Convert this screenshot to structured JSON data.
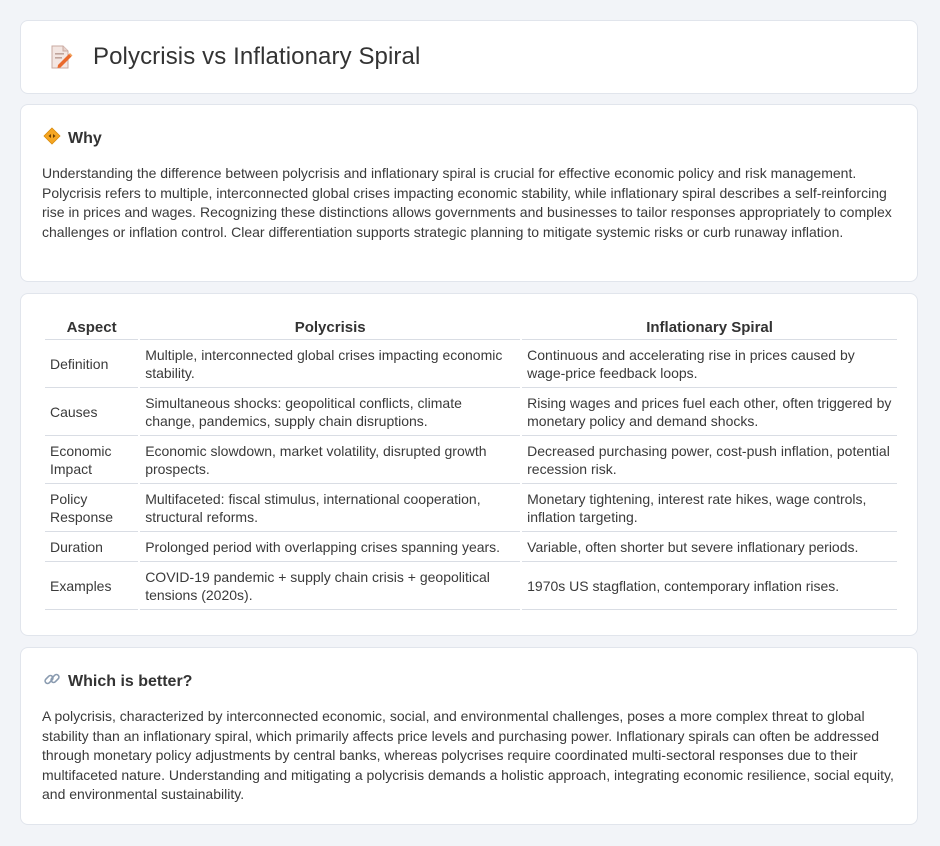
{
  "page": {
    "title": "Polycrisis vs Inflationary Spiral",
    "title_icon": "document-pencil-icon"
  },
  "why": {
    "icon": "diamond-arrows-icon",
    "heading": "Why",
    "body": "Understanding the difference between polycrisis and inflationary spiral is crucial for effective economic policy and risk management. Polycrisis refers to multiple, interconnected global crises impacting economic stability, while inflationary spiral describes a self-reinforcing rise in prices and wages. Recognizing these distinctions allows governments and businesses to tailor responses appropriately to complex challenges or inflation control. Clear differentiation supports strategic planning to mitigate systemic risks or curb runaway inflation."
  },
  "comparison": {
    "headers": [
      "Aspect",
      "Polycrisis",
      "Inflationary Spiral"
    ],
    "rows": [
      {
        "aspect": "Definition",
        "polycrisis": "Multiple, interconnected global crises impacting economic stability.",
        "inflationary": "Continuous and accelerating rise in prices caused by wage-price feedback loops."
      },
      {
        "aspect": "Causes",
        "polycrisis": "Simultaneous shocks: geopolitical conflicts, climate change, pandemics, supply chain disruptions.",
        "inflationary": "Rising wages and prices fuel each other, often triggered by monetary policy and demand shocks."
      },
      {
        "aspect": "Economic Impact",
        "polycrisis": "Economic slowdown, market volatility, disrupted growth prospects.",
        "inflationary": "Decreased purchasing power, cost-push inflation, potential recession risk."
      },
      {
        "aspect": "Policy Response",
        "polycrisis": "Multifaceted: fiscal stimulus, international cooperation, structural reforms.",
        "inflationary": "Monetary tightening, interest rate hikes, wage controls, inflation targeting."
      },
      {
        "aspect": "Duration",
        "polycrisis": "Prolonged period with overlapping crises spanning years.",
        "inflationary": "Variable, often shorter but severe inflationary periods."
      },
      {
        "aspect": "Examples",
        "polycrisis": "COVID-19 pandemic + supply chain crisis + geopolitical tensions (2020s).",
        "inflationary": "1970s US stagflation, contemporary inflation rises."
      }
    ]
  },
  "better": {
    "icon": "link-icon",
    "heading": "Which is better?",
    "body": "A polycrisis, characterized by interconnected economic, social, and environmental challenges, poses a more complex threat to global stability than an inflationary spiral, which primarily affects price levels and purchasing power. Inflationary spirals can often be addressed through monetary policy adjustments by central banks, whereas polycrises require coordinated multi-sectoral responses due to their multifaceted nature. Understanding and mitigating a polycrisis demands a holistic approach, integrating economic resilience, social equity, and environmental sustainability."
  }
}
